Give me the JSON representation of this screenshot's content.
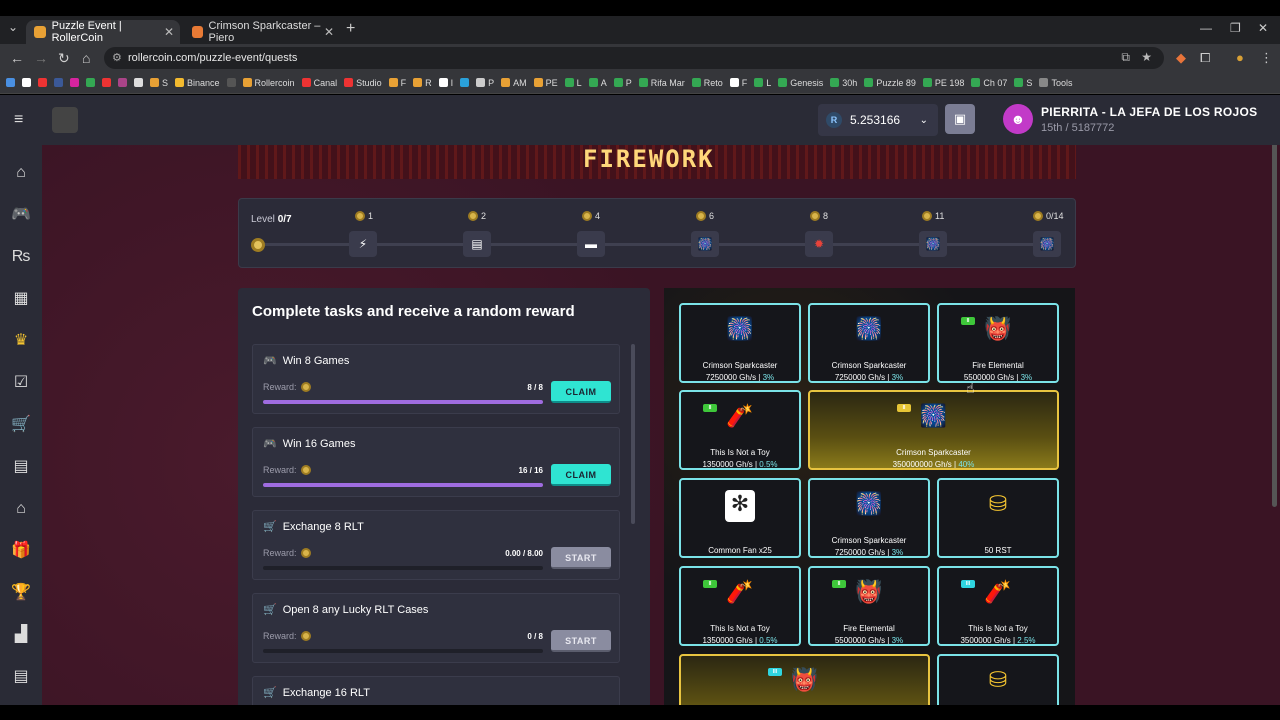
{
  "browser": {
    "tabs": [
      {
        "title": "Puzzle Event | RollerCoin",
        "active": true
      },
      {
        "title": "Crimson Sparkcaster – Piero",
        "active": false
      }
    ],
    "url": "rollercoin.com/puzzle-event/quests",
    "bookmarks": [
      "S",
      "Binance",
      "Rollercoin",
      "Canal",
      "Studio",
      "F",
      "R",
      "I",
      "P",
      "AM",
      "PE",
      "L",
      "A",
      "P",
      "Rifa Mar",
      "Reto",
      "F",
      "L",
      "Genesis",
      "30h",
      "Puzzle 89",
      "PE 198",
      "Ch 07",
      "S",
      "Tools"
    ]
  },
  "header": {
    "balance": "5.253166",
    "balance_token": "R",
    "username": "PIERRITA - LA JEFA DE LOS ROJOS",
    "rank": "15th / 5187772"
  },
  "banner": {
    "title": "FIREWORK"
  },
  "level": {
    "label": "Level",
    "value": "0/7",
    "steps": [
      {
        "count": "1",
        "icon": "⚡"
      },
      {
        "count": "2",
        "icon": "▤"
      },
      {
        "count": "4",
        "icon": "▬"
      },
      {
        "count": "6",
        "icon": "🎆"
      },
      {
        "count": "8",
        "icon": "✹"
      },
      {
        "count": "11",
        "icon": "🎆"
      },
      {
        "count": "0/14",
        "icon": "🎆"
      }
    ]
  },
  "tasks": {
    "title": "Complete tasks and receive a random reward",
    "reward_label": "Reward:",
    "items": [
      {
        "name": "Win 8 Games",
        "icon": "gamepad-icon",
        "progress": "8 / 8",
        "fill": 1.0,
        "action": "CLAIM"
      },
      {
        "name": "Win 16 Games",
        "icon": "gamepad-icon",
        "progress": "16 / 16",
        "fill": 1.0,
        "action": "CLAIM"
      },
      {
        "name": "Exchange 8 RLT",
        "icon": "cart-icon",
        "progress": "0.00 / 8.00",
        "fill": 0,
        "action": "START"
      },
      {
        "name": "Open 8 any Lucky RLT Cases",
        "icon": "cart-icon",
        "progress": "0 / 8",
        "fill": 0,
        "action": "START"
      },
      {
        "name": "Exchange 16 RLT",
        "icon": "cart-icon",
        "progress": "",
        "fill": 0,
        "action": ""
      }
    ]
  },
  "rewards": [
    {
      "name": "Crimson Sparkcaster",
      "power": "7250000 Gh/s",
      "pct": "3%",
      "gold": false,
      "tag": ""
    },
    {
      "name": "Crimson Sparkcaster",
      "power": "7250000 Gh/s",
      "pct": "3%",
      "gold": false,
      "tag": ""
    },
    {
      "name": "Fire Elemental",
      "power": "5500000 Gh/s",
      "pct": "3%",
      "gold": false,
      "tag": "green"
    },
    {
      "name": "This Is Not a Toy",
      "power": "1350000 Gh/s",
      "pct": "0.5%",
      "gold": false,
      "tag": "green"
    },
    {
      "name": "Crimson Sparkcaster",
      "power": "350000000 Gh/s",
      "pct": "40%",
      "gold": true,
      "tag": "yellow"
    },
    {
      "name": "Common Fan x25",
      "power": "",
      "pct": "",
      "gold": false,
      "tag": ""
    },
    {
      "name": "Crimson Sparkcaster",
      "power": "7250000 Gh/s",
      "pct": "3%",
      "gold": false,
      "tag": ""
    },
    {
      "name": "50 RST",
      "power": "",
      "pct": "",
      "gold": false,
      "tag": ""
    },
    {
      "name": "This Is Not a Toy",
      "power": "1350000 Gh/s",
      "pct": "0.5%",
      "gold": false,
      "tag": "green"
    },
    {
      "name": "Fire Elemental",
      "power": "5500000 Gh/s",
      "pct": "3%",
      "gold": false,
      "tag": "green"
    },
    {
      "name": "This Is Not a Toy",
      "power": "3500000 Gh/s",
      "pct": "2.5%",
      "gold": false,
      "tag": "teal"
    }
  ],
  "colors": {
    "accent_claim": "#2fe4d2",
    "progress_fill": "#9f6ce0",
    "card_border": "#7be3e8",
    "gold_border": "#e8c440",
    "app_bg": "#3a1424"
  }
}
